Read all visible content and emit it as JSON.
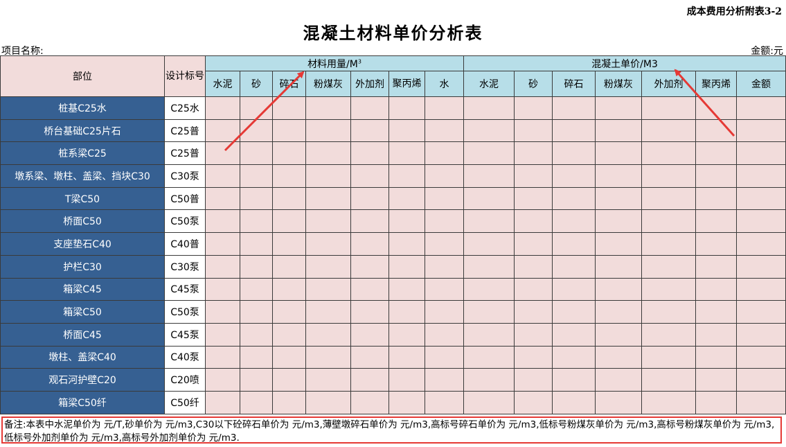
{
  "header": {
    "appendix_label": "成本费用分析附表3-2",
    "title": "混凝土材料单价分析表",
    "project_label": "项目名称:",
    "amount_label": "金额:元"
  },
  "table": {
    "col_part": "部位",
    "col_std": "设计标号",
    "group_material": "材料用量/M",
    "group_material_sup": "3",
    "group_price": "混凝土单价/M3",
    "material_cols": [
      "水泥",
      "砂",
      "碎石",
      "粉煤灰",
      "外加剂",
      "聚丙烯",
      "水"
    ],
    "price_cols": [
      "水泥",
      "砂",
      "碎石",
      "粉煤灰",
      "外加剂",
      "聚丙烯",
      "金额"
    ],
    "rows": [
      {
        "part": "桩基C25水",
        "std": "C25水"
      },
      {
        "part": "桥台基础C25片石",
        "std": "C25普"
      },
      {
        "part": "桩系梁C25",
        "std": "C25普"
      },
      {
        "part": "墩系梁、墩柱、盖梁、挡块C30",
        "std": "C30泵"
      },
      {
        "part": "T梁C50",
        "std": "C50普"
      },
      {
        "part": "桥面C50",
        "std": "C50泵"
      },
      {
        "part": "支座垫石C40",
        "std": "C40普"
      },
      {
        "part": "护栏C30",
        "std": "C30泵"
      },
      {
        "part": "箱梁C45",
        "std": "C45泵"
      },
      {
        "part": "箱梁C50",
        "std": "C50泵"
      },
      {
        "part": "桥面C45",
        "std": "C45泵"
      },
      {
        "part": "墩柱、盖梁C40",
        "std": "C40泵"
      },
      {
        "part": "观石河护壁C20",
        "std": "C20喷"
      },
      {
        "part": "箱梁C50纤",
        "std": "C50纤"
      }
    ]
  },
  "note": {
    "text": "备注:本表中水泥单价为  元/T,砂单价为  元/m3,C30以下砼碎石单价为  元/m3,薄壁墩碎石单价为  元/m3,高标号碎石单价为  元/m3,低标号粉煤灰单价为  元/m3,高标号粉煤灰单价为  元/m3,低标号外加剂单价为  元/m3,高标号外加剂单价为  元/m3."
  },
  "colors": {
    "part_bg": "#366092",
    "header_blue": "#b7dee8",
    "cell_pink": "#f2dcdb",
    "annotation_red": "#e53935"
  }
}
